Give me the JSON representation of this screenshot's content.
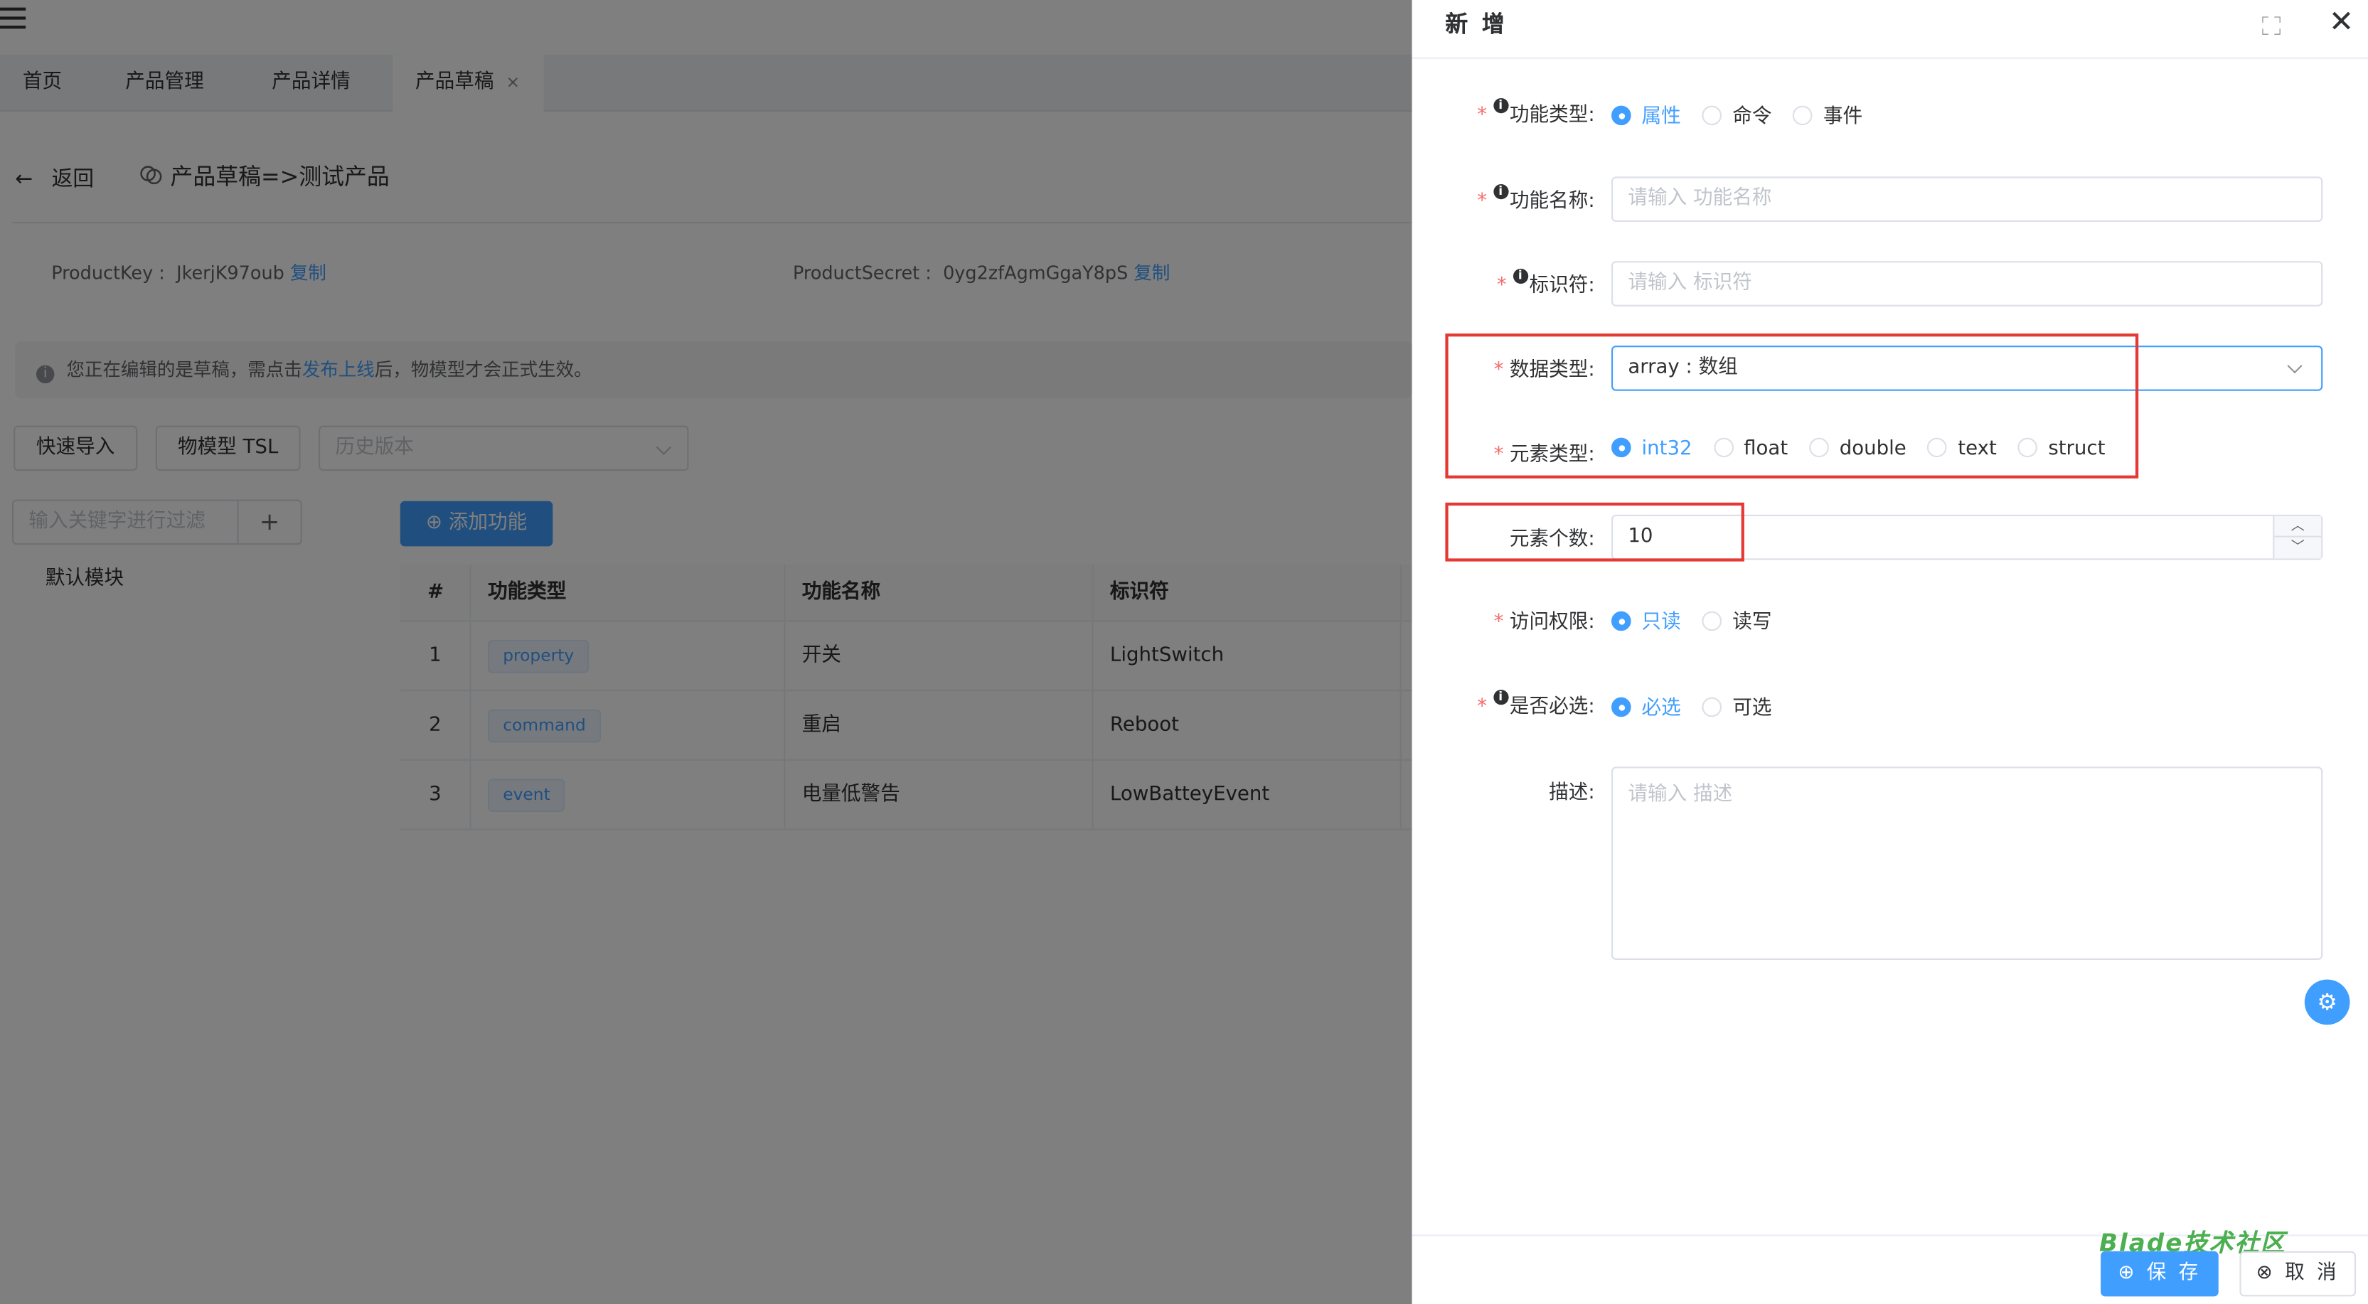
{
  "tabs": [
    "首页",
    "产品管理",
    "产品详情",
    "产品草稿"
  ],
  "tab_close": "×",
  "page": {
    "back_arrow": "←",
    "back_label": "返回",
    "title_icon": "copy-icon",
    "title": "产品草稿=>测试产品",
    "product_key_label": "ProductKey :",
    "product_key_value": "JkerjK97oub",
    "product_secret_label": "ProductSecret :",
    "product_secret_value": "0yg2zfAgmGgaY8pS",
    "copy_label": "复制",
    "alert_icon": "i",
    "alert_pre": "您正在编辑的是草稿，需点击",
    "alert_link": "发布上线",
    "alert_post": "后，物模型才会正式生效。",
    "quick_import": "快速导入",
    "tsl_button": "物模型 TSL",
    "history_placeholder": "历史版本",
    "filter_placeholder": "输入关键字进行过滤",
    "filter_add": "+",
    "module_name": "默认模块",
    "add_icon": "⊕",
    "add_function": "添加功能"
  },
  "table": {
    "headers": [
      "#",
      "功能类型",
      "功能名称",
      "标识符"
    ],
    "rows": [
      {
        "index": "1",
        "type": "property",
        "name": "开关",
        "identifier": "LightSwitch"
      },
      {
        "index": "2",
        "type": "command",
        "name": "重启",
        "identifier": "Reboot"
      },
      {
        "index": "3",
        "type": "event",
        "name": "电量低警告",
        "identifier": "LowBatteyEvent"
      }
    ]
  },
  "drawer": {
    "title": "新 增",
    "close": "✕",
    "required_mark": "*",
    "info_mark": "i",
    "function_type": {
      "label": "功能类型:",
      "options": [
        "属性",
        "命令",
        "事件"
      ],
      "selected": 0
    },
    "function_name": {
      "label": "功能名称:",
      "placeholder": "请输入 功能名称"
    },
    "identifier": {
      "label": "标识符:",
      "placeholder": "请输入 标识符"
    },
    "data_type": {
      "label": "数据类型:",
      "value": "array : 数组"
    },
    "element_type": {
      "label": "元素类型:",
      "options": [
        "int32",
        "float",
        "double",
        "text",
        "struct"
      ],
      "selected": 0
    },
    "element_count": {
      "label": "元素个数:",
      "value": "10",
      "up": "︿",
      "down": "﹀"
    },
    "access": {
      "label": "访问权限:",
      "options": [
        "只读",
        "读写"
      ],
      "selected": 0
    },
    "required": {
      "label": "是否必选:",
      "options": [
        "必选",
        "可选"
      ],
      "selected": 0
    },
    "description": {
      "label": "描述:",
      "placeholder": "请输入 描述"
    },
    "gear_icon": "⚙",
    "save_icon": "⊕",
    "save": "保 存",
    "cancel_icon": "⊗",
    "cancel": "取 消",
    "watermark": "Blade技术社区"
  },
  "colors": {
    "primary": "#409eff",
    "danger": "#f56c6c",
    "highlight": "#e53935"
  }
}
